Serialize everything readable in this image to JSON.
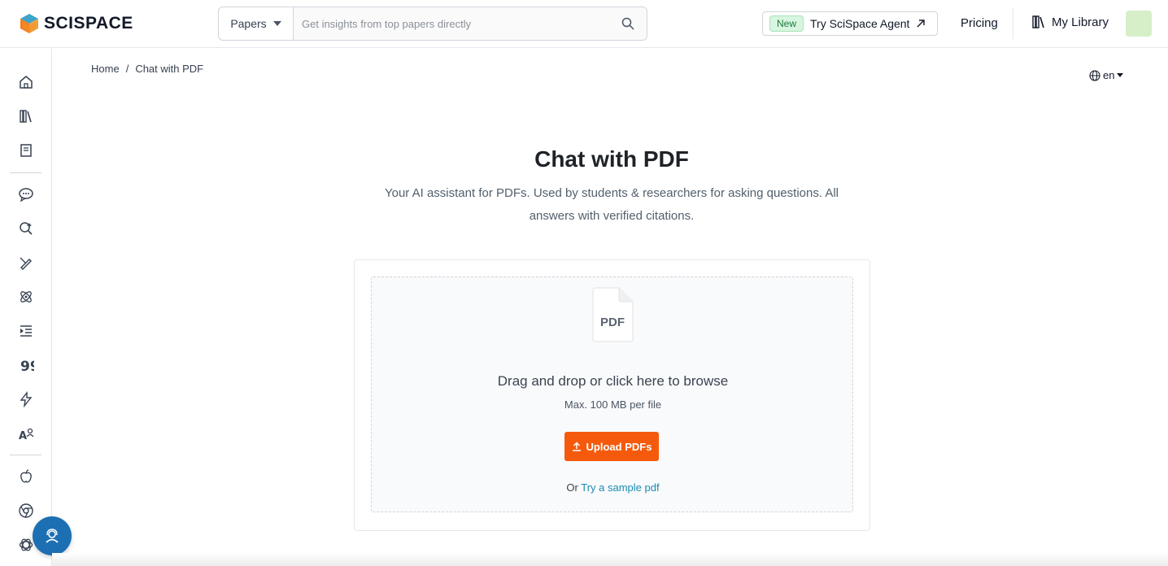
{
  "header": {
    "logo_text": "SCISPACE",
    "search_type": "Papers",
    "search_placeholder": "Get insights from top papers directly",
    "new_badge": "New",
    "agent_label": "Try SciSpace Agent",
    "pricing_label": "Pricing",
    "library_label": "My Library"
  },
  "sidebar": {
    "items": [
      {
        "icon": "home-icon"
      },
      {
        "icon": "library-icon"
      },
      {
        "icon": "notebook-icon"
      },
      {
        "icon": "chat-icon"
      },
      {
        "icon": "literature-review-icon"
      },
      {
        "icon": "ai-writer-icon"
      },
      {
        "icon": "extract-data-icon"
      },
      {
        "icon": "paraphraser-icon"
      },
      {
        "icon": "citation-generator-icon"
      },
      {
        "icon": "ai-detector-icon"
      },
      {
        "icon": "pdf-to-video-icon"
      },
      {
        "icon": "apple-icon"
      },
      {
        "icon": "chrome-icon"
      },
      {
        "icon": "openai-icon"
      }
    ]
  },
  "breadcrumb": {
    "home": "Home",
    "separator": "/",
    "current": "Chat with PDF"
  },
  "language": "en",
  "main": {
    "title": "Chat with PDF",
    "subtitle": "Your AI assistant for PDFs. Used by students & researchers for asking questions. All answers with verified citations.",
    "file_icon_label": "PDF",
    "drop_text": "Drag and drop or click here to browse",
    "max_text": "Max. 100 MB per file",
    "upload_label": "Upload PDFs",
    "sample_prefix": "Or",
    "sample_link": "Try a sample pdf"
  },
  "colors": {
    "accent": "#f55a0c",
    "link": "#1a8bb3",
    "fab": "#1c6fb3",
    "badge_bg": "#d7f5df"
  }
}
